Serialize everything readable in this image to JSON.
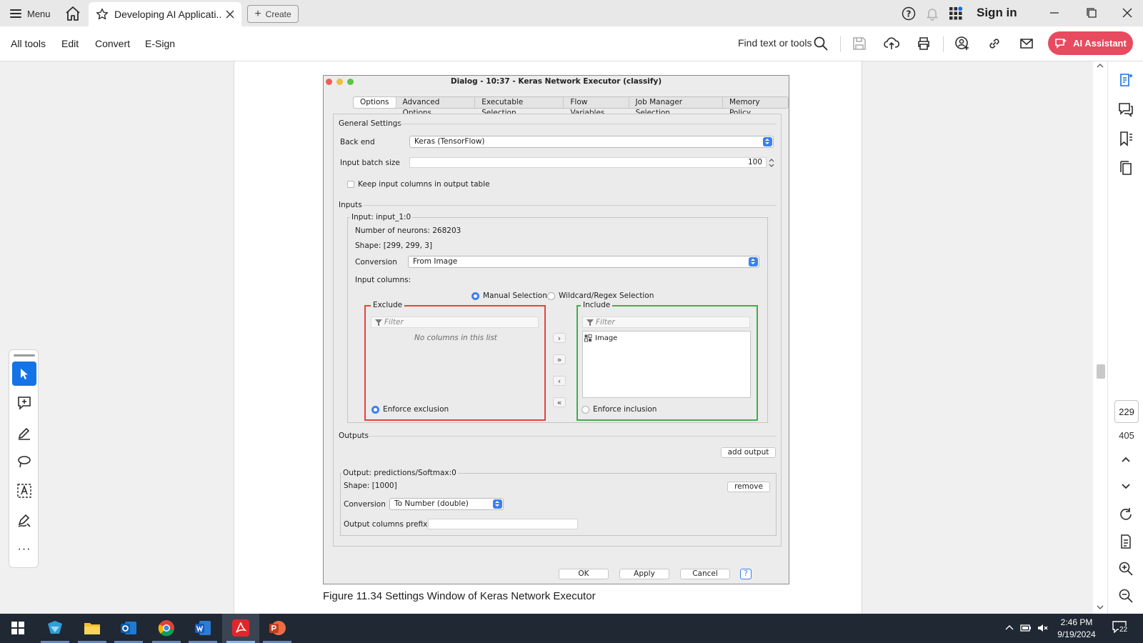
{
  "browser": {
    "menu_label": "Menu",
    "tab_title": "Developing AI Applicati...",
    "create_label": "Create",
    "signin_label": "Sign in"
  },
  "toolbar": {
    "items": [
      "All tools",
      "Edit",
      "Convert",
      "E-Sign"
    ],
    "find_label": "Find text or tools",
    "ai_label": "AI Assistant",
    "icons": [
      "save-icon",
      "upload-icon",
      "print-icon",
      "share-user-icon",
      "link-icon",
      "mail-icon"
    ]
  },
  "page_nav": {
    "current_page": "229",
    "total_pages": "405"
  },
  "dialog": {
    "title": "Dialog - 10:37 - Keras Network Executor (classify)",
    "tabs": [
      "Options",
      "Advanced Options",
      "Executable Selection",
      "Flow Variables",
      "Job Manager Selection",
      "Memory Policy"
    ],
    "selected_tab": "Options",
    "general_settings": {
      "heading": "General Settings",
      "backend_label": "Back end",
      "backend_value": "Keras (TensorFlow)",
      "batch_label": "Input batch size",
      "batch_value": "100",
      "keep_label": "Keep input columns in output table"
    },
    "inputs": {
      "heading": "Inputs",
      "group_title": "Input: input_1:0",
      "neurons": "Number of neurons: 268203",
      "shape": "Shape: [299, 299, 3]",
      "conversion_label": "Conversion",
      "conversion_value": "From Image",
      "columns_label": "Input columns:",
      "mode_manual": "Manual Selection",
      "mode_wildcard": "Wildcard/Regex Selection",
      "exclude_title": "Exclude",
      "include_title": "Include",
      "filter_placeholder": "Filter",
      "exclude_empty": "No columns in this list",
      "include_items": [
        "Image"
      ],
      "enforce_exclusion": "Enforce exclusion",
      "enforce_inclusion": "Enforce inclusion"
    },
    "outputs": {
      "heading": "Outputs",
      "add_output": "add output",
      "group_title": "Output: predictions/Softmax:0",
      "shape": "Shape: [1000]",
      "remove": "remove",
      "conversion_label": "Conversion",
      "conversion_value": "To Number (double)",
      "prefix_label": "Output columns prefix"
    },
    "buttons": {
      "ok": "OK",
      "apply": "Apply",
      "cancel": "Cancel",
      "help": "?"
    }
  },
  "figure_caption": "Figure 11.34  Settings Window of Keras Network Executor",
  "taskbar": {
    "time": "2:46 PM",
    "date": "9/19/2024",
    "notification_count": "22"
  },
  "colors": {
    "accent": "#1473e6",
    "ai_button": "#e84a5f",
    "exclude_border": "#e0453a",
    "include_border": "#3fae49",
    "taskbar": "#1f2833"
  }
}
